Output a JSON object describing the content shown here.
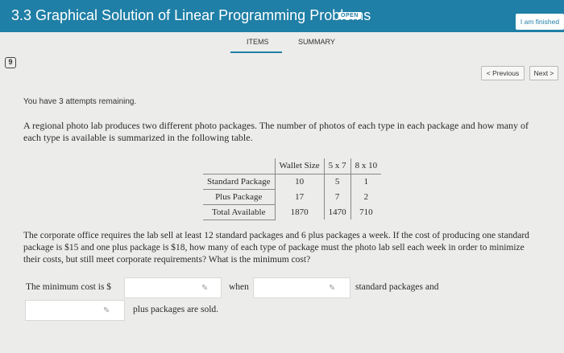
{
  "header": {
    "title": "3.3 Graphical Solution of Linear Programming Problems",
    "badge": "OPEN",
    "finish_label": "I am finished"
  },
  "tabs": [
    {
      "label": "ITEMS"
    },
    {
      "label": "SUMMARY"
    }
  ],
  "question_number": "9",
  "nav": {
    "previous_label": "< Previous",
    "next_label": "Next >"
  },
  "attempts_text": "You have 3 attempts remaining.",
  "intro_text": "A regional photo lab produces two different photo packages. The number of photos of each type in each package and how many of each type is available is summarized in the following table.",
  "table": {
    "headers": [
      "Wallet Size",
      "5 x 7",
      "8 x 10"
    ],
    "rows": [
      {
        "label": "Standard Package",
        "values": [
          "10",
          "5",
          "1"
        ]
      },
      {
        "label": "Plus Package",
        "values": [
          "17",
          "7",
          "2"
        ]
      },
      {
        "label": "Total Available",
        "values": [
          "1870",
          "1470",
          "710"
        ]
      }
    ]
  },
  "problem_text": "The corporate office requires the lab sell at least 12 standard packages and 6 plus packages a week. If the cost of producing one standard package is $15 and one plus package is $18, how many of each type of package must the photo lab sell each week in order to minimize their costs, but still meet corporate requirements? What is the minimum cost?",
  "answer": {
    "prefix": "The minimum cost is $",
    "when": "when",
    "standard_suffix": "standard packages and",
    "plus_suffix": "plus packages are sold.",
    "cost_value": "",
    "standard_value": "",
    "plus_value": ""
  },
  "icons": {
    "edit": "pencil-icon",
    "question": "question-number-icon"
  },
  "colors": {
    "header_bg": "#1f7fa6",
    "background": "#ececea"
  }
}
